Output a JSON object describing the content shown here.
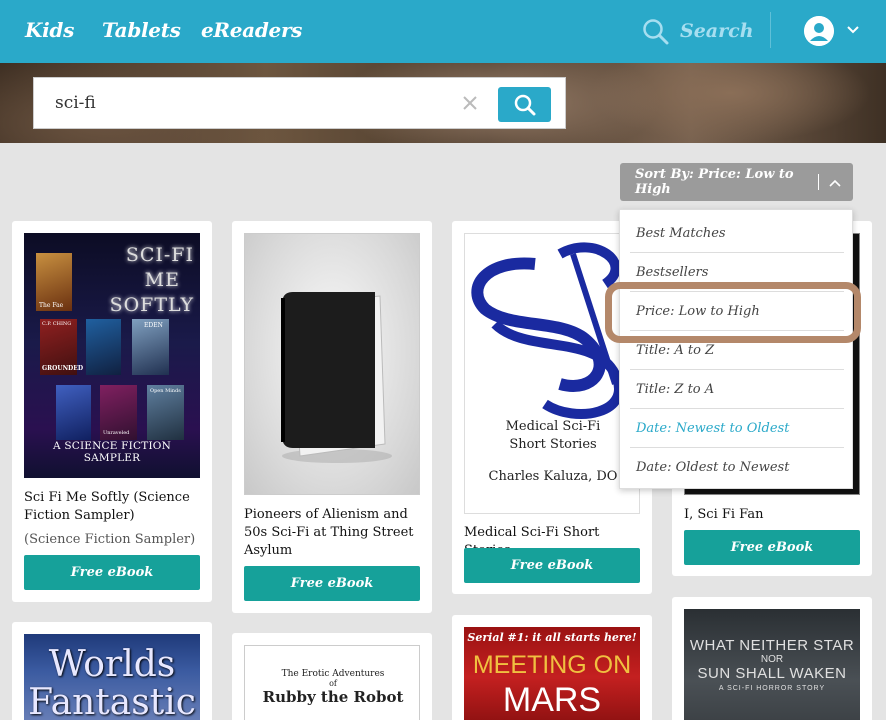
{
  "nav": {
    "kids": "Kids",
    "tablets": "Tablets",
    "ereaders": "eReaders",
    "search_label": "Search"
  },
  "search": {
    "value": "sci-fi"
  },
  "sort": {
    "label": "Sort By: Price: Low to High",
    "options": [
      "Best Matches",
      "Bestsellers",
      "Price: Low to High",
      "Title: A to Z",
      "Title: Z to A",
      "Date: Newest to Oldest",
      "Date: Oldest to Newest"
    ]
  },
  "books": [
    {
      "title": "Sci Fi Me Softly (Science Fiction Sampler)",
      "subtitle": "(Science Fiction Sampler)",
      "action": "Free eBook",
      "cover": {
        "line1": "SCI-FI",
        "line2": "ME",
        "line3": "SOFTLY",
        "footer": "A SCIENCE FICTION SAMPLER",
        "tag1": "The Fae",
        "tag2": "C.P. CHING",
        "tag3": "GROUNDED",
        "tag4": "EDEN",
        "tag5": "Unraveled",
        "tag6": "Open Minds"
      }
    },
    {
      "title": "Pioneers of Alienism and 50s Sci-Fi at Thing Street Asylum",
      "action": "Free eBook"
    },
    {
      "title": "Medical Sci-Fi Short Stories",
      "action": "Free eBook",
      "cover": {
        "line1": "Medical Sci-Fi",
        "line2": "Short Stories",
        "author": "Charles Kaluza, DO"
      }
    },
    {
      "title": "I, Sci Fi Fan",
      "action": "Free eBook"
    },
    {
      "cover": {
        "line1": "Worlds",
        "line2": "Fantastic"
      }
    },
    {
      "cover": {
        "line1": "The Erotic Adventures",
        "line2": "of",
        "line3": "Rubby the Robot"
      }
    },
    {
      "cover": {
        "banner": "Serial #1: it all starts here!",
        "line1": "MEETING ON",
        "line2": "MARS"
      }
    },
    {
      "cover": {
        "line1": "WHAT NEITHER STAR",
        "line2": "NOR",
        "line3": "SUN SHALL WAKEN",
        "line4": "A SCI-FI HORROR STORY"
      }
    }
  ],
  "colors": {
    "nav": "#2aa9c9",
    "button": "#16a19a",
    "highlight": "#b4886a",
    "active_option": "#2aa9c9"
  }
}
